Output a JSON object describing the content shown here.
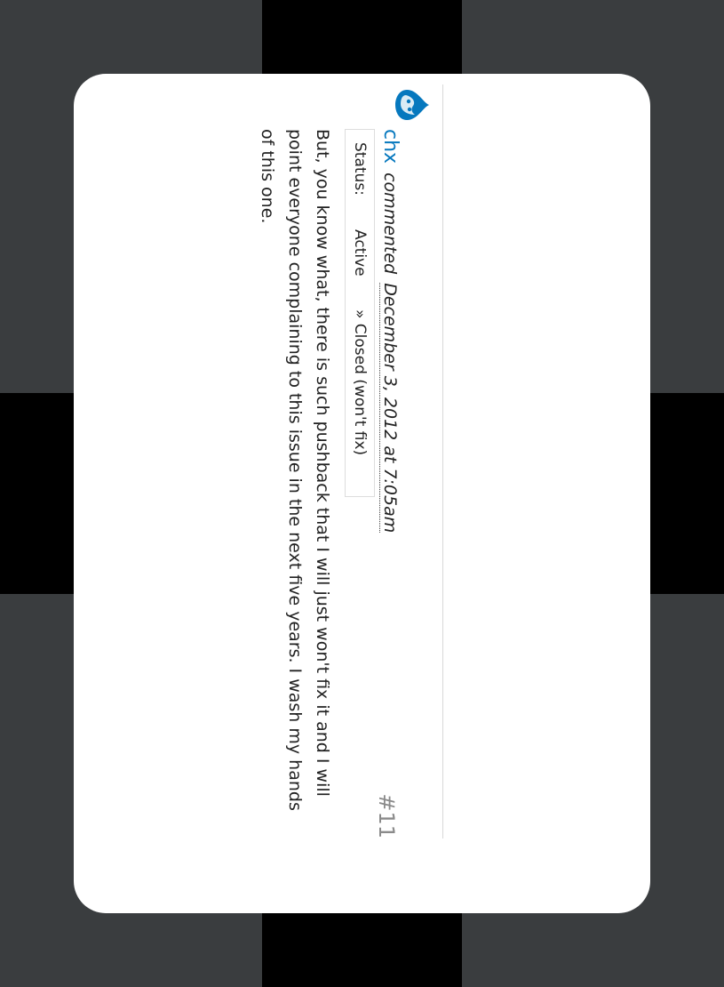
{
  "comment": {
    "number": "#11",
    "author": "chx",
    "verb": "commented",
    "date": "December 3, 2012 at 7:05am",
    "status_label": "Status:",
    "status_old": "Active",
    "status_new": "» Closed (won't fix)",
    "body": "But, you know what, there is such pushback that I will just won't fix it and I will point everyone complaining to this issue in the next five years. I wash my hands of this one."
  },
  "colors": {
    "username": "#0678be",
    "avatar": "#0678be",
    "page_bg": "#3a3d3f",
    "card_bg": "#ffffff"
  },
  "icons": {
    "avatar": "drupal-drop-icon"
  }
}
